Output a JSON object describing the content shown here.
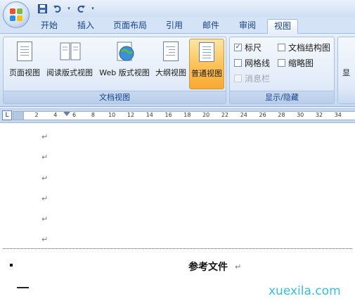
{
  "titlebar": {
    "qat_icons": [
      "save-icon",
      "undo-icon",
      "redo-icon"
    ],
    "title": ""
  },
  "tabs": [
    {
      "label": "开始"
    },
    {
      "label": "插入"
    },
    {
      "label": "页面布局"
    },
    {
      "label": "引用"
    },
    {
      "label": "邮件"
    },
    {
      "label": "审阅"
    },
    {
      "label": "视图",
      "active": true
    }
  ],
  "ribbon": {
    "doc_views": {
      "label": "文档视图",
      "buttons": [
        {
          "label": "页面视图"
        },
        {
          "label": "阅读版式视图"
        },
        {
          "label": "Web 版式视图"
        },
        {
          "label": "大纲视图"
        },
        {
          "label": "普通视图",
          "selected": true
        }
      ]
    },
    "show_hide": {
      "label": "显示/隐藏",
      "items": [
        {
          "label": "标尺",
          "checked": true
        },
        {
          "label": "文档结构图",
          "checked": false
        },
        {
          "label": "网格线",
          "checked": false
        },
        {
          "label": "缩略图",
          "checked": false
        },
        {
          "label": "消息栏",
          "checked": false,
          "disabled": true
        }
      ]
    },
    "cut_label": "显"
  },
  "ruler": {
    "tab_selector": "L",
    "ticks": [
      "2",
      "4",
      "6",
      "8",
      "10",
      "12",
      "14",
      "16",
      "18",
      "20",
      "22",
      "24",
      "26",
      "28",
      "30",
      "32",
      "34"
    ]
  },
  "document": {
    "paragraph_mark": "↵",
    "ref_title": "参考文件",
    "watermark": "xuexila.com"
  },
  "colors": {
    "selected_button": "#f9a733",
    "ribbon_text": "#15428b",
    "watermark": "#33c0d8"
  }
}
